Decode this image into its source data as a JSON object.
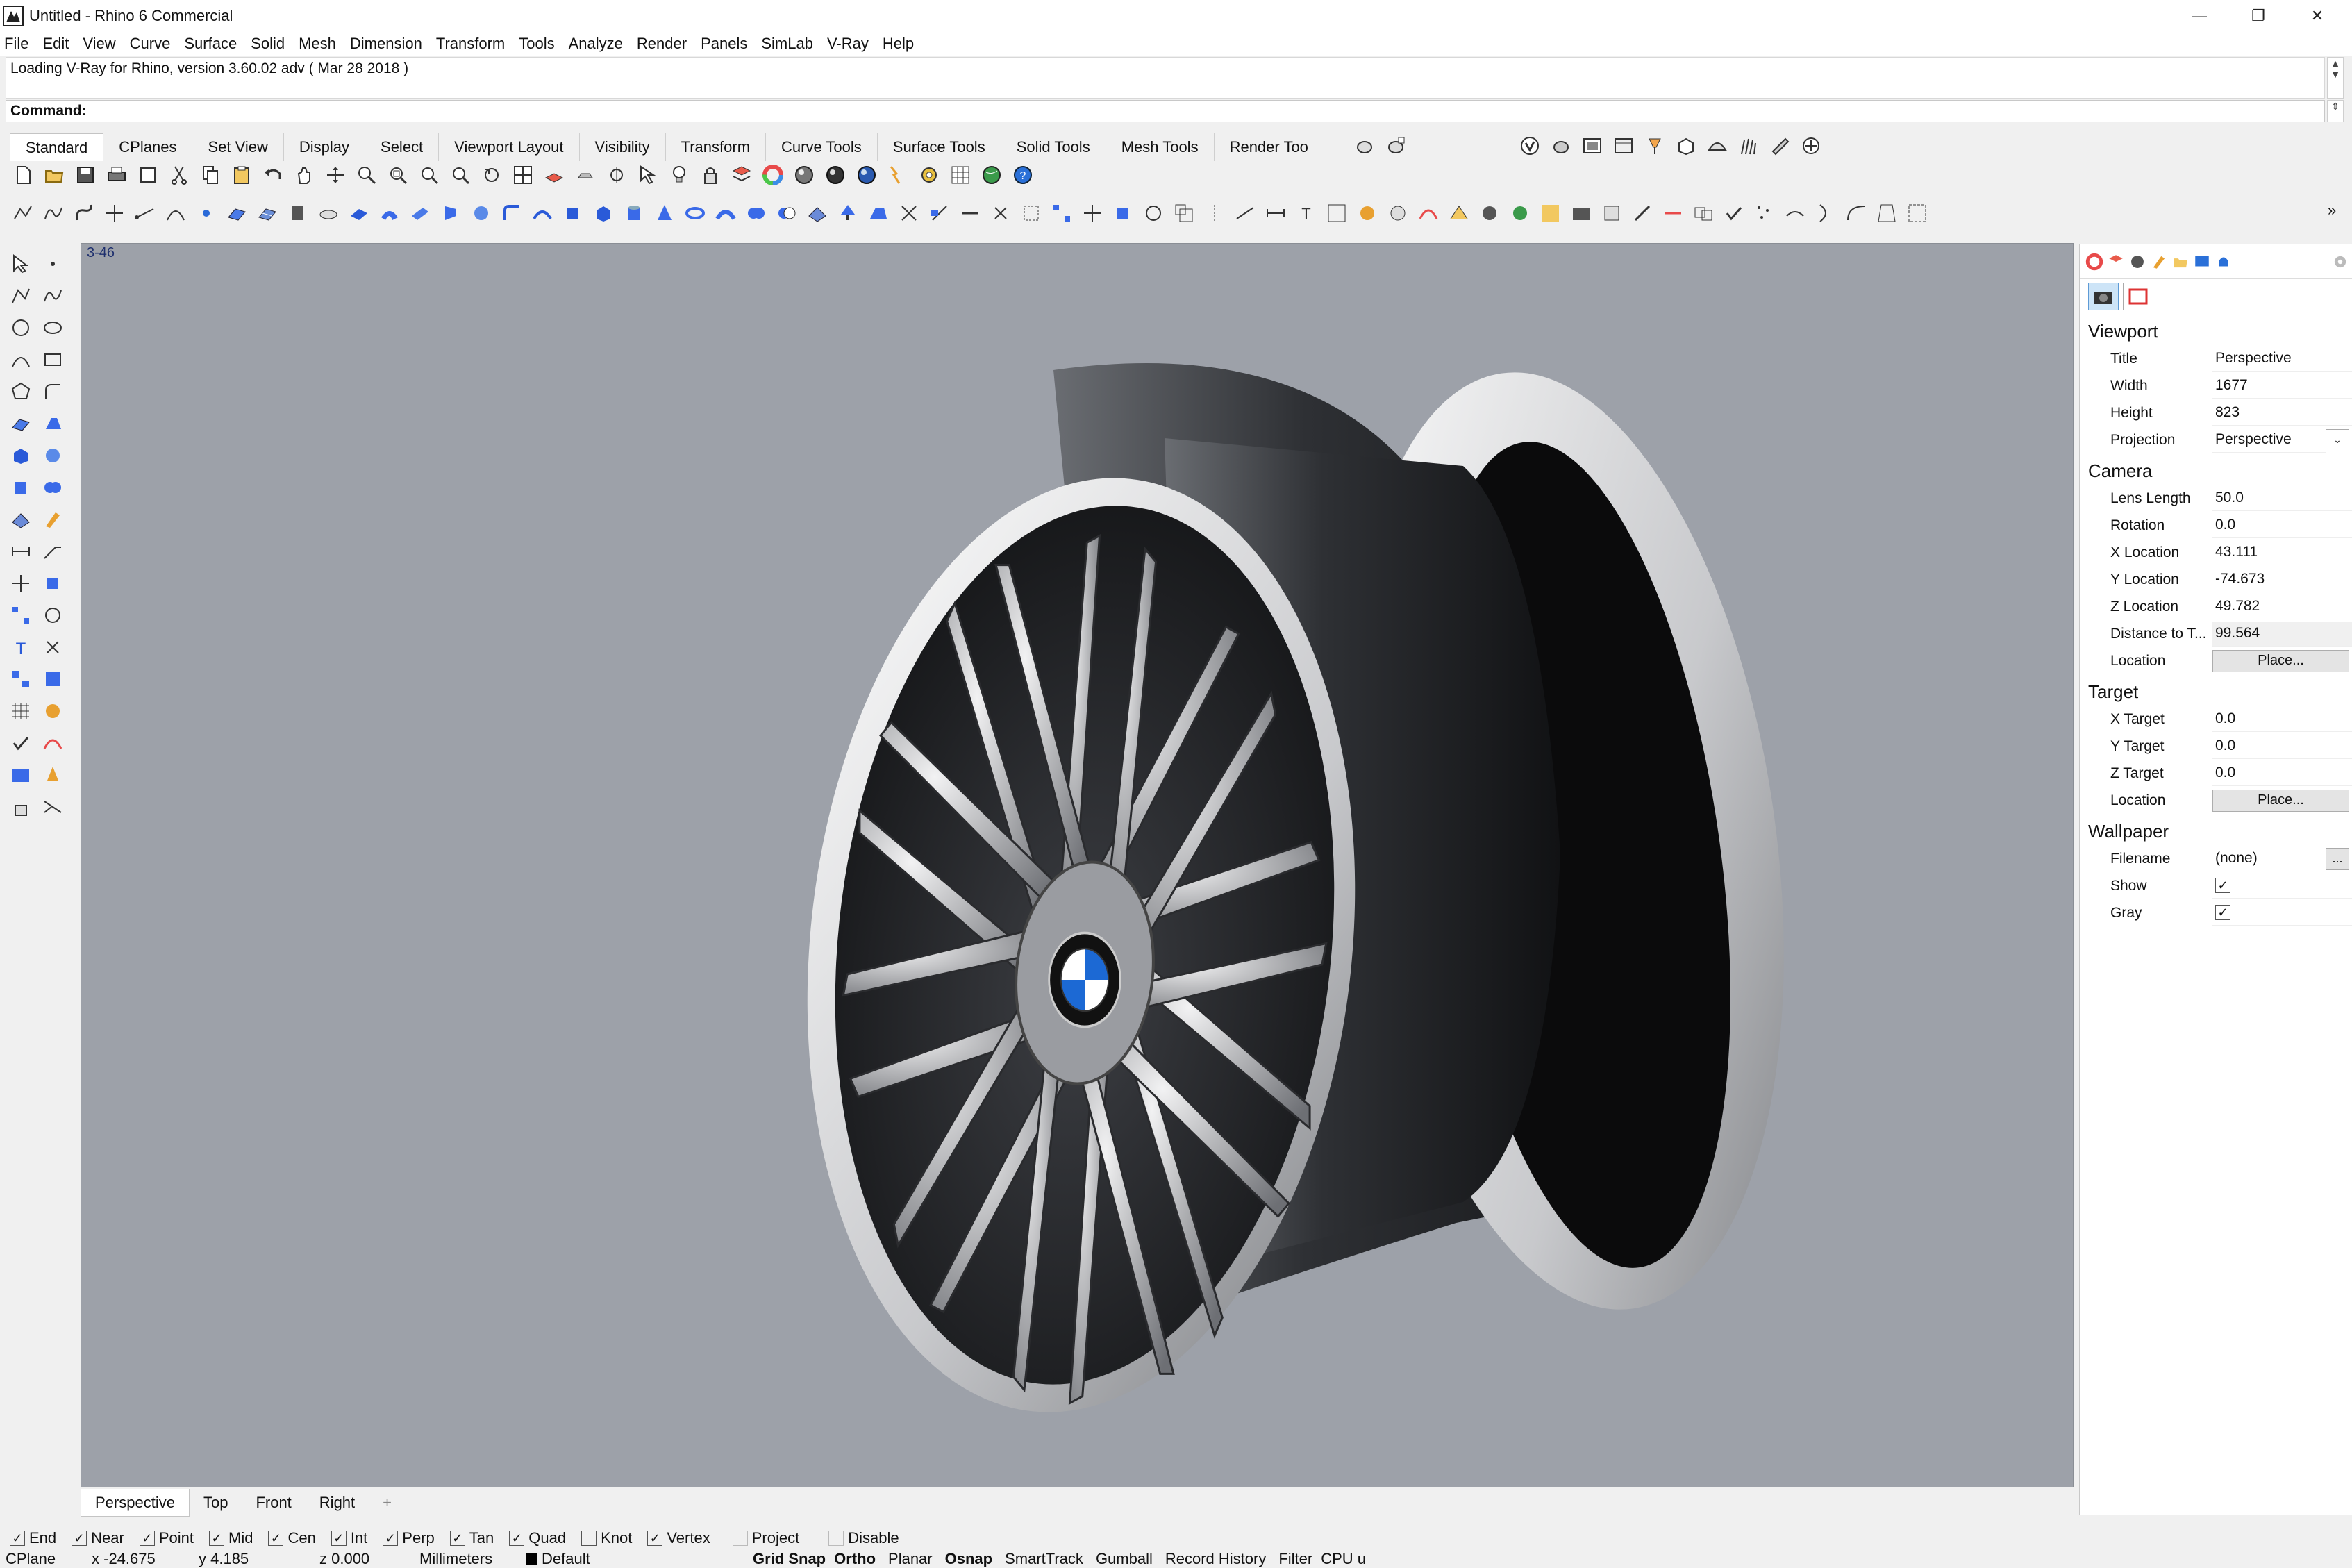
{
  "window": {
    "title": "Untitled - Rhino 6 Commercial",
    "minimize": "—",
    "restore": "❐",
    "close": "✕"
  },
  "menu": [
    "File",
    "Edit",
    "View",
    "Curve",
    "Surface",
    "Solid",
    "Mesh",
    "Dimension",
    "Transform",
    "Tools",
    "Analyze",
    "Render",
    "Panels",
    "SimLab",
    "V-Ray",
    "Help"
  ],
  "command": {
    "history": "Loading V-Ray for Rhino, version 3.60.02 adv ( Mar 28 2018 )",
    "label": "Command:",
    "value": ""
  },
  "toolbar_tabs": [
    "Standard",
    "CPlanes",
    "Set View",
    "Display",
    "Select",
    "Viewport Layout",
    "Visibility",
    "Transform",
    "Curve Tools",
    "Surface Tools",
    "Solid Tools",
    "Mesh Tools",
    "Render Too"
  ],
  "viewport": {
    "label": "3-46",
    "name": "Perspective"
  },
  "viewport_tabs": [
    "Perspective",
    "Top",
    "Front",
    "Right",
    "+"
  ],
  "panel": {
    "sections": {
      "viewport": "Viewport",
      "camera": "Camera",
      "target": "Target",
      "wallpaper": "Wallpaper"
    },
    "viewport": {
      "title_k": "Title",
      "title_v": "Perspective",
      "width_k": "Width",
      "width_v": "1677",
      "height_k": "Height",
      "height_v": "823",
      "projection_k": "Projection",
      "projection_v": "Perspective"
    },
    "camera": {
      "lens_k": "Lens Length",
      "lens_v": "50.0",
      "rotation_k": "Rotation",
      "rotation_v": "0.0",
      "x_k": "X Location",
      "x_v": "43.111",
      "y_k": "Y Location",
      "y_v": "-74.673",
      "z_k": "Z Location",
      "z_v": "49.782",
      "dist_k": "Distance to T...",
      "dist_v": "99.564",
      "loc_k": "Location",
      "loc_btn": "Place..."
    },
    "target": {
      "x_k": "X Target",
      "x_v": "0.0",
      "y_k": "Y Target",
      "y_v": "0.0",
      "z_k": "Z Target",
      "z_v": "0.0",
      "loc_k": "Location",
      "loc_btn": "Place..."
    },
    "wallpaper": {
      "file_k": "Filename",
      "file_v": "(none)",
      "file_btn": "...",
      "show_k": "Show",
      "show_checked": true,
      "gray_k": "Gray",
      "gray_checked": true
    }
  },
  "osnap": [
    {
      "label": "End",
      "checked": true
    },
    {
      "label": "Near",
      "checked": true
    },
    {
      "label": "Point",
      "checked": true
    },
    {
      "label": "Mid",
      "checked": true
    },
    {
      "label": "Cen",
      "checked": true
    },
    {
      "label": "Int",
      "checked": true
    },
    {
      "label": "Perp",
      "checked": true
    },
    {
      "label": "Tan",
      "checked": true
    },
    {
      "label": "Quad",
      "checked": true
    },
    {
      "label": "Knot",
      "checked": false
    },
    {
      "label": "Vertex",
      "checked": true
    },
    {
      "label": "Project",
      "checked": false
    },
    {
      "label": "Disable",
      "checked": false
    }
  ],
  "status": {
    "cplane": "CPlane",
    "x": "x -24.675",
    "y": "y 4.185",
    "z": "z 0.000",
    "units": "Millimeters",
    "layer": "Default",
    "grid_snap": "Grid Snap",
    "ortho": "Ortho",
    "planar": "Planar",
    "osnap": "Osnap",
    "smarttrack": "SmartTrack",
    "gumball": "Gumball",
    "record_history": "Record History",
    "filter": "Filter",
    "cpu": "CPU u"
  },
  "colors": {
    "viewport_bg": "#9da1a9",
    "bmw_blue": "#1c69d4",
    "active_tab": "#ffffff"
  }
}
